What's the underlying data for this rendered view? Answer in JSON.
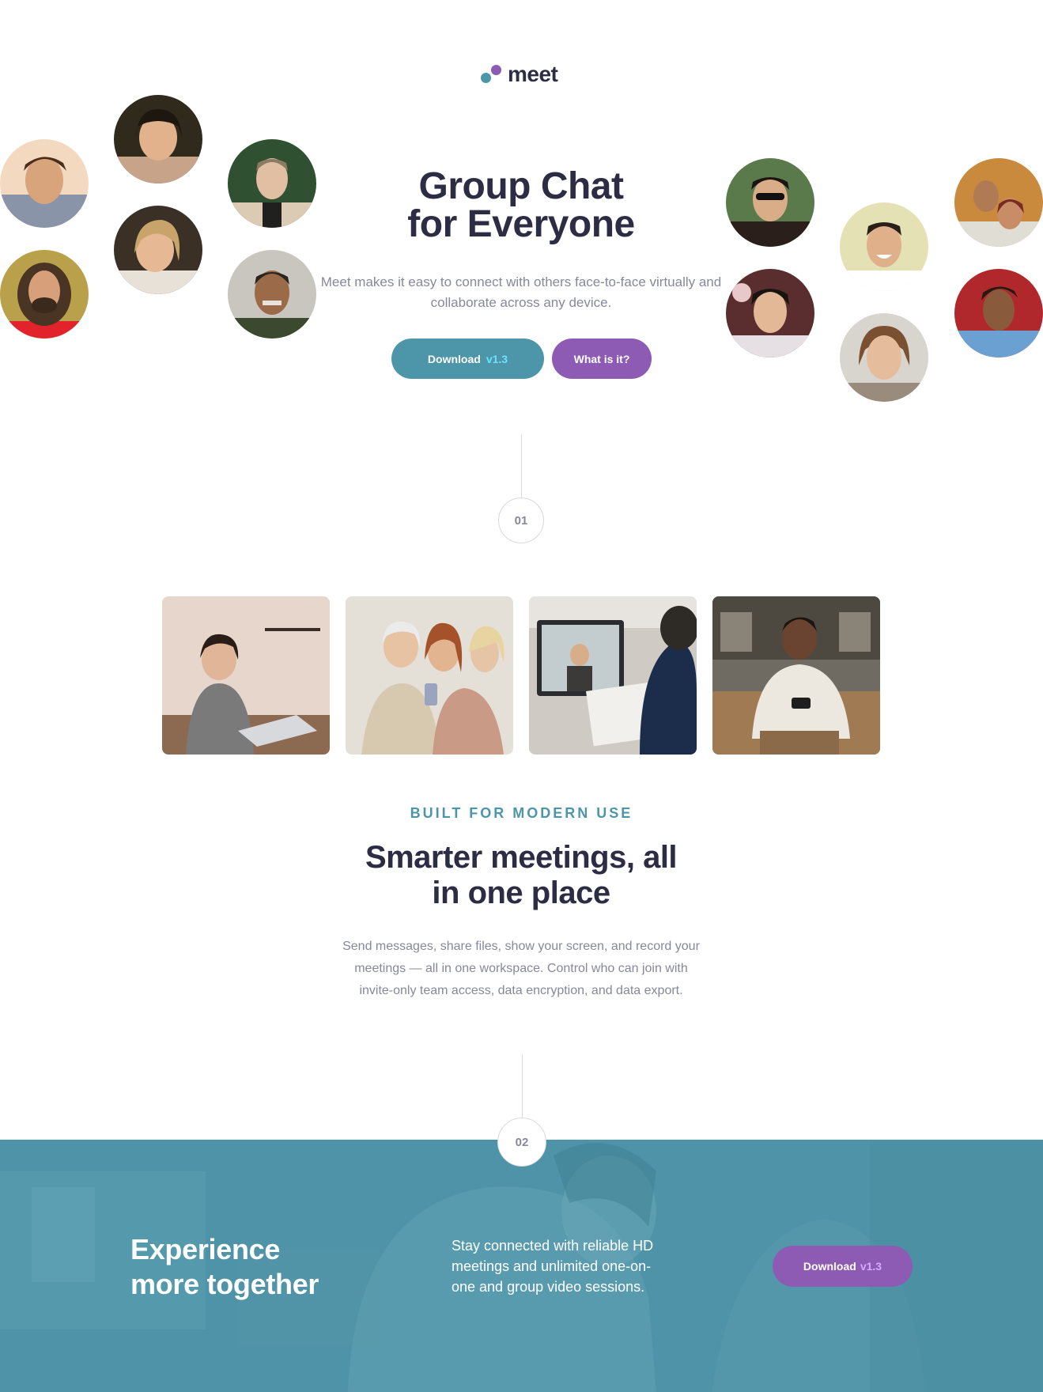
{
  "brand": {
    "name": "meet",
    "colors": {
      "primary_teal": "#4d96a9",
      "primary_purple": "#8d5bb4",
      "heading": "#2c2c45",
      "body_text": "#87879d",
      "version_highlight": "#6ee1ff"
    }
  },
  "hero": {
    "title_line1": "Group Chat",
    "title_line2": "for Everyone",
    "subtitle": "Meet makes it easy to connect with others face-to-face virtually and collaborate across any device.",
    "download_button": {
      "label": "Download",
      "version": "v1.3"
    },
    "what_button": {
      "label": "What is it?"
    }
  },
  "avatars": {
    "left": [
      "person-avatar",
      "person-avatar",
      "person-avatar",
      "person-avatar",
      "person-avatar",
      "person-avatar"
    ],
    "right": [
      "person-avatar",
      "person-avatar",
      "person-avatar",
      "person-avatar",
      "person-avatar",
      "person-avatar"
    ]
  },
  "steps": {
    "first": "01",
    "second": "02"
  },
  "photos": [
    {
      "alt": "woman-with-laptop-in-kitchen"
    },
    {
      "alt": "three-women-looking-at-phone"
    },
    {
      "alt": "man-on-video-call"
    },
    {
      "alt": "man-using-phone"
    }
  ],
  "features": {
    "kicker": "BUILT FOR MODERN USE",
    "title_line1": "Smarter meetings, all",
    "title_line2": "in one place",
    "body": "Send messages, share files, show your screen, and record your meetings — all in one workspace. Control who can join with invite-only team access, data encryption, and data export."
  },
  "cta": {
    "title_line1": "Experience",
    "title_line2": "more together",
    "text": "Stay connected with reliable HD meetings and unlimited one-on-one and group video sessions.",
    "download_button": {
      "label": "Download",
      "version": "v1.3"
    }
  }
}
